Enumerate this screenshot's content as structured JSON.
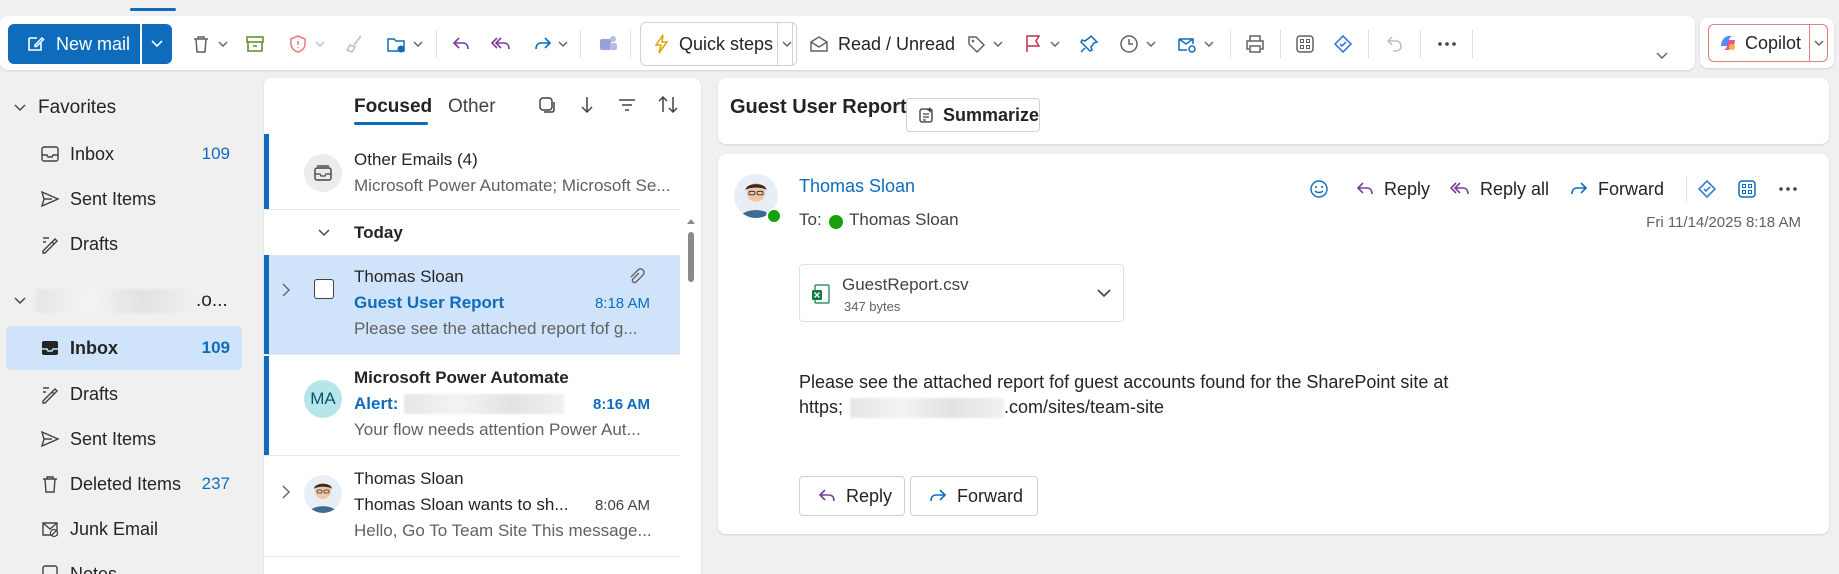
{
  "toolbar": {
    "new_mail": "New mail",
    "quick_steps": "Quick steps",
    "read_unread": "Read / Unread",
    "copilot": "Copilot"
  },
  "nav": {
    "favorites_header": "Favorites",
    "favorites": [
      {
        "label": "Inbox",
        "count": "109",
        "icon": "inbox-icon"
      },
      {
        "label": "Sent Items",
        "count": "",
        "icon": "send-icon"
      },
      {
        "label": "Drafts",
        "count": "",
        "icon": "drafts-icon"
      }
    ],
    "account_suffix": ".o...",
    "folders": [
      {
        "label": "Inbox",
        "count": "109",
        "icon": "inbox-icon"
      },
      {
        "label": "Drafts",
        "count": "",
        "icon": "drafts-icon"
      },
      {
        "label": "Sent Items",
        "count": "",
        "icon": "send-icon"
      },
      {
        "label": "Deleted Items",
        "count": "237",
        "icon": "trash-icon"
      },
      {
        "label": "Junk Email",
        "count": "",
        "icon": "junk-icon"
      },
      {
        "label": "Notes",
        "count": "",
        "icon": "notes-icon"
      }
    ]
  },
  "list": {
    "tab_focused": "Focused",
    "tab_other": "Other",
    "group_other": {
      "title": "Other Emails (4)",
      "preview": "Microsoft Power Automate; Microsoft Se..."
    },
    "today_label": "Today",
    "messages": [
      {
        "from": "Thomas Sloan",
        "subject": "Guest User Report",
        "time": "8:18 AM",
        "preview": "Please see the attached report fof g..."
      },
      {
        "avatar": "MA",
        "from": "Microsoft Power Automate",
        "subject": "Alert:",
        "time": "8:16 AM",
        "preview": "Your flow needs attention Power Aut..."
      },
      {
        "from": "Thomas Sloan",
        "subject": "Thomas Sloan wants to sh...",
        "time": "8:06 AM",
        "preview": "Hello, Go To Team Site This message..."
      }
    ]
  },
  "reading": {
    "title": "Guest User Report",
    "summarize": "Summarize",
    "sender": "Thomas Sloan",
    "to_label": "To:",
    "to_name": "Thomas Sloan",
    "date": "Fri 11/14/2025 8:18 AM",
    "actions": {
      "reply": "Reply",
      "reply_all": "Reply all",
      "forward": "Forward"
    },
    "attachment": {
      "name": "GuestReport.csv",
      "size": "347 bytes"
    },
    "body_line1": "Please see the attached report fof guest accounts found for the SharePoint site at",
    "body_prefix": "https;",
    "body_suffix": ".com/sites/team-site",
    "bottom_reply": "Reply",
    "bottom_forward": "Forward"
  },
  "colors": {
    "accent": "#0f6cbd",
    "selected_bg": "#cfe4fa"
  }
}
